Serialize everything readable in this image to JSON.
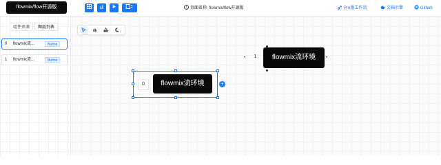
{
  "header": {
    "logo_text": "flowmix/flow开源版",
    "title_label": "页面名称:",
    "title_value": "flowmix/flow开源版",
    "links": {
      "pro": "Pro版工作流",
      "docs": "文档引擎",
      "github": "Github"
    },
    "toolbar": {
      "btn1_icon": "grid-icon",
      "btn2_icon": "chart-icon",
      "btn3_icon": "play-icon",
      "btn4_icon": "save-icon"
    }
  },
  "sidebar": {
    "tabs": [
      "组件资源",
      "图层列表"
    ],
    "items": [
      {
        "index": "0",
        "name": "flowmix流...",
        "badge": "Button"
      },
      {
        "index": "1",
        "name": "flowmix流...",
        "badge": "Button"
      }
    ]
  },
  "canvas": {
    "tools": [
      "pointer-icon",
      "hand-icon",
      "grid-shape-icon",
      "moon-icon"
    ],
    "nodes": [
      {
        "index": "1",
        "label": "flowmix流环境"
      },
      {
        "index": "0",
        "label": "flowmix流环境"
      }
    ],
    "add_label": "+"
  },
  "colors": {
    "accent": "#1677ff",
    "node_bg": "#0a0a0a"
  }
}
